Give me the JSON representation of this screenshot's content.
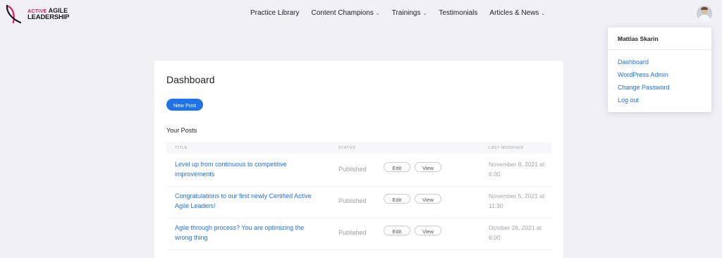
{
  "logo": {
    "line1_accent": "ACTIVE",
    "line1": "AGILE",
    "line2": "LEADERSHIP"
  },
  "nav": [
    {
      "label": "Practice Library",
      "has_dropdown": false
    },
    {
      "label": "Content Champions",
      "has_dropdown": true
    },
    {
      "label": "Trainings",
      "has_dropdown": true
    },
    {
      "label": "Testimonials",
      "has_dropdown": false
    },
    {
      "label": "Articles & News",
      "has_dropdown": true
    }
  ],
  "icons": {
    "dropdown": "chevron-down-icon",
    "avatar": "user-avatar",
    "logo": "logo-mark-icon"
  },
  "colors": {
    "accent": "#1e73e8",
    "brand": "#e4166a",
    "background": "#f0f0f5"
  },
  "dashboard": {
    "title": "Dashboard",
    "new_post_label": "New Post",
    "your_posts_label": "Your Posts",
    "columns": {
      "title": "TITLE",
      "status": "STATUS",
      "modified": "LAST MODIFIED"
    },
    "posts": [
      {
        "title": "Level up from continuous to competitive improvements",
        "status": "Published",
        "edit": "Edit",
        "view": "View",
        "modified": "November 8, 2021 at 6:00"
      },
      {
        "title": "Congratulations to our first newly Certified Active Agile Leaders!",
        "status": "Published",
        "edit": "Edit",
        "view": "View",
        "modified": "November 5, 2021 at 11:30"
      },
      {
        "title": "Agile through process? You are optimizing the wrong thing",
        "status": "Published",
        "edit": "Edit",
        "view": "View",
        "modified": "October 26, 2021 at 6:00"
      }
    ]
  },
  "user_menu": {
    "name": "Mattias Skarin",
    "items": [
      "Dashboard",
      "WordPress Admin",
      "Change Password",
      "Log out"
    ]
  }
}
